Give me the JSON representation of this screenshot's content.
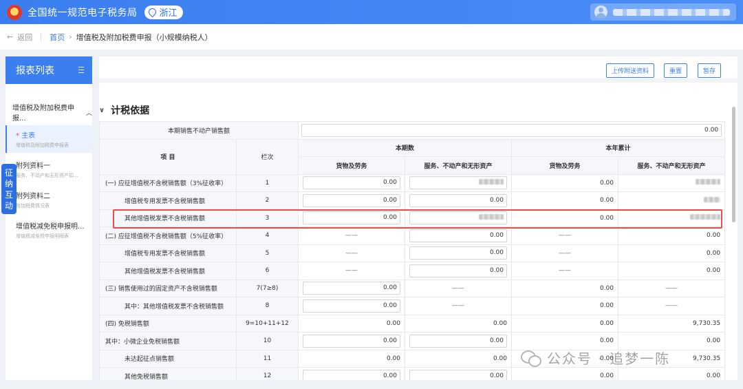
{
  "header": {
    "site_title": "全国统一规范电子税务局",
    "region": "浙江"
  },
  "breadcrumb": {
    "back_label": "返回",
    "home": "首页",
    "current": "增值税及附加税费申报（小规模纳税人）"
  },
  "sidebar": {
    "title": "报表列表",
    "group_label": "增值税及附加税费申报...",
    "items": [
      {
        "required": "*",
        "title": "主表",
        "subtitle": "增值税及附加税费申报表"
      },
      {
        "required": "",
        "title": "附列资料一",
        "subtitle": "服务、不动产和无形资产扣..."
      },
      {
        "required": "",
        "title": "附列资料二",
        "subtitle": "附加税费情况表"
      },
      {
        "required": "",
        "title": "增值税减免税申报明...",
        "subtitle": "增值税减免税申报明细表"
      }
    ],
    "float_tab": "征纳互动"
  },
  "toolbar": {
    "upload_label": "上传附送资料",
    "reset_label": "重置",
    "save_label": "暂存"
  },
  "section": {
    "title": "计税依据"
  },
  "table": {
    "real_estate_label": "本期销售不动产销售额",
    "real_estate_value": "0.00",
    "h_item": "项  目",
    "h_col": "栏次",
    "h_current": "本期数",
    "h_ytd": "本年累计",
    "h_goods": "货物及劳务",
    "h_service": "服务、不动产和无形资产",
    "dash": "——",
    "rows": [
      {
        "label": "(一) 应征增值税不含税销售额（3%征收率）",
        "col": "1",
        "c1": "0.00",
        "c2": "",
        "c3": "0.00",
        "c4": ""
      },
      {
        "label": "增值税专用发票不含税销售额",
        "col": "2",
        "c1": "0.00",
        "c2": "0.00",
        "c3": "0.00",
        "c4": ""
      },
      {
        "label": "其他增值税发票不含税销售额",
        "col": "3",
        "c1": "0.00",
        "c2": "",
        "c3": "0.00",
        "c4": ""
      },
      {
        "label": "(二) 应征增值税不含税销售额（5%征收率）",
        "col": "4",
        "c1": "",
        "c2": "0.00",
        "c3": "",
        "c4": "0.00"
      },
      {
        "label": "增值税专用发票不含税销售额",
        "col": "5",
        "c1": "",
        "c2": "0.00",
        "c3": "",
        "c4": "0.00"
      },
      {
        "label": "其他增值税发票不含税销售额",
        "col": "6",
        "c1": "",
        "c2": "0.00",
        "c3": "",
        "c4": "0.00"
      },
      {
        "label": "(三) 销售使用过的固定资产不含税销售额",
        "col": "7(7≥8)",
        "c1": "0.00",
        "c2": "",
        "c3": "0.00",
        "c4": ""
      },
      {
        "label": "其中：其他增值税发票不含税销售额",
        "col": "8",
        "c1": "0.00",
        "c2": "",
        "c3": "0.00",
        "c4": ""
      },
      {
        "label": "(四) 免税销售额",
        "col": "9=10+11+12",
        "c1": "0.00",
        "c2": "0.00",
        "c3": "0.00",
        "c4": "9,730.35"
      },
      {
        "label": "其中：小微企业免税销售额",
        "col": "10",
        "c1": "0.00",
        "c2": "0.00",
        "c3": "0.00",
        "c4": "0.00"
      },
      {
        "label": "未达起征点销售额",
        "col": "11",
        "c1": "0.00",
        "c2": "0.00",
        "c3": "0.00",
        "c4": "9,730.35"
      },
      {
        "label": "其他免税销售额",
        "col": "12",
        "c1": "0.00",
        "c2": "0.00",
        "c3": "0.00",
        "c4": "0.00"
      }
    ]
  },
  "watermark": "公众号 · 追梦一陈",
  "colors": {
    "primary": "#3b7ef0",
    "highlight": "#e84c4c"
  }
}
